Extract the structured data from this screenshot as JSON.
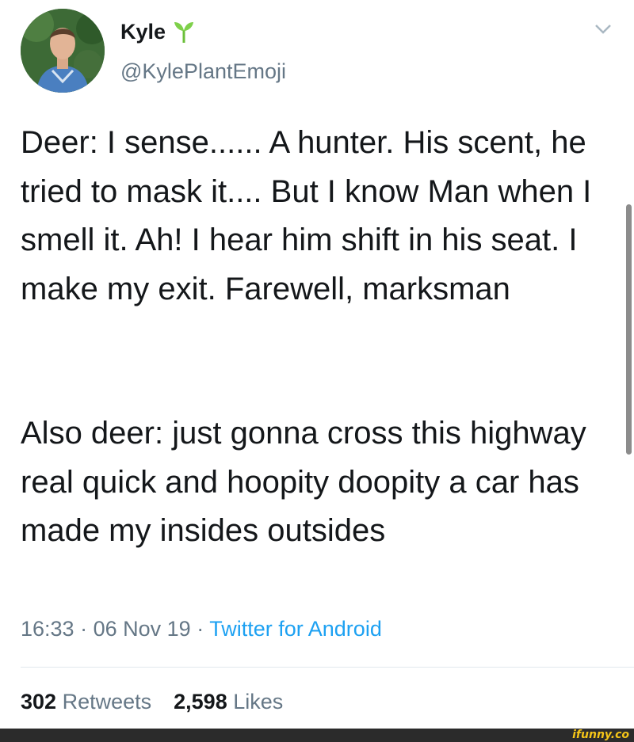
{
  "user": {
    "display_name": "Kyle",
    "handle": "@KylePlantEmoji",
    "name_emoji_icon": "seedling-icon",
    "avatar_icon": "profile-photo"
  },
  "tweet": {
    "paragraph_1": "Deer: I sense...... A hunter. His scent, he tried to mask it.... But I know Man when I smell it. Ah! I hear him shift in his seat. I make my exit. Farewell, marksman",
    "paragraph_2": "Also deer: just gonna cross this highway real quick and hoopity doopity a car has made my insides outsides",
    "time": "16:33",
    "date": "06 Nov 19",
    "separator": "·",
    "source": "Twitter for Android"
  },
  "stats": {
    "retweets_count": "302",
    "retweets_label": "Retweets",
    "likes_count": "2,598",
    "likes_label": "Likes"
  },
  "menu": {
    "icon": "chevron-down-icon"
  },
  "watermark": {
    "text": "ifunny.co"
  },
  "colors": {
    "text_primary": "#14171a",
    "text_secondary": "#657786",
    "link": "#1da1f2",
    "footer_bg": "#2b2b2b",
    "watermark": "#f5c518"
  }
}
